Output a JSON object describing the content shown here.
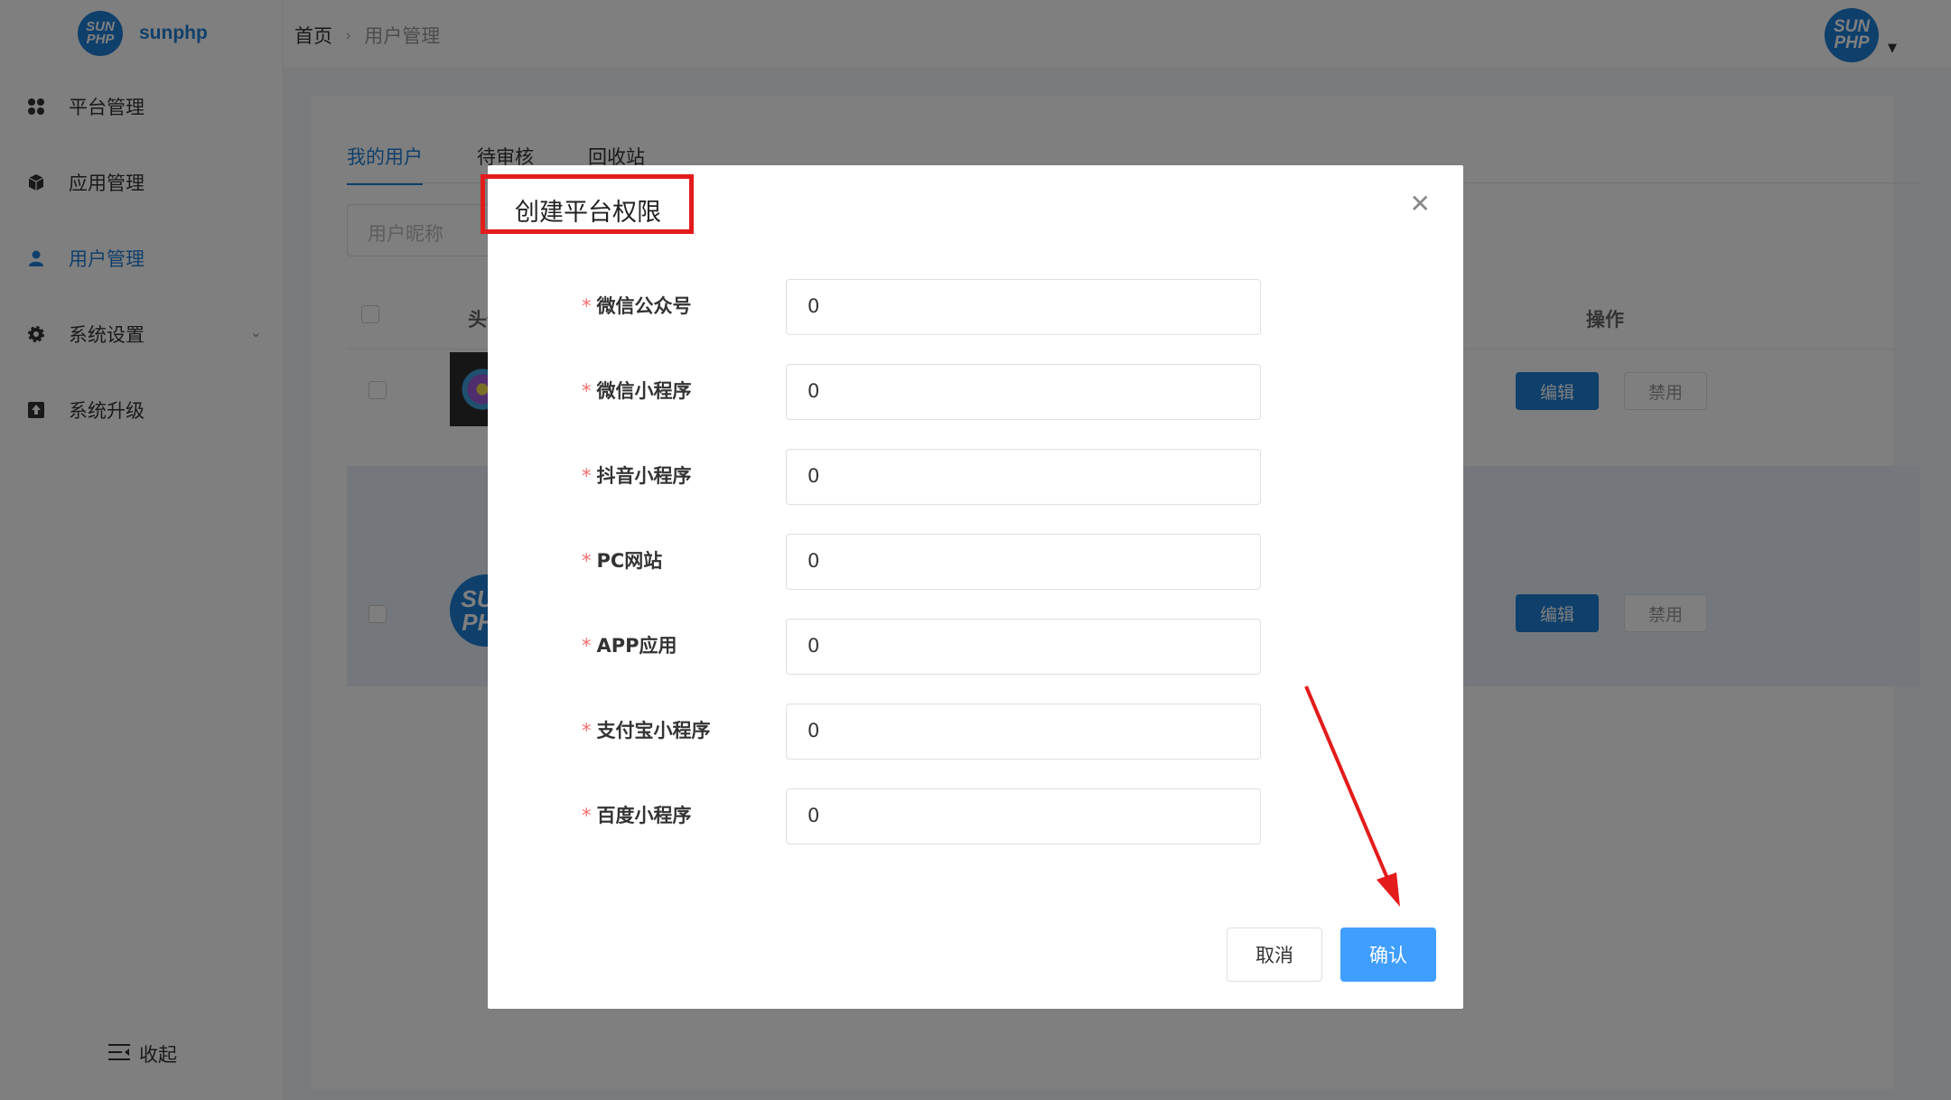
{
  "brand": {
    "name": "sunphp",
    "logo_line1": "SUN",
    "logo_line2": "PHP"
  },
  "colors": {
    "primary": "#1e7fd6",
    "dialog_primary": "#409eff",
    "highlight_box": "#e31b1b",
    "required": "#f56c6c"
  },
  "sidebar": {
    "items": [
      {
        "label": "平台管理",
        "icon": "grid-icon"
      },
      {
        "label": "应用管理",
        "icon": "cube-icon"
      },
      {
        "label": "用户管理",
        "icon": "user-icon",
        "active": true
      },
      {
        "label": "系统设置",
        "icon": "gear-icon"
      },
      {
        "label": "系统升级",
        "icon": "upload-icon"
      }
    ],
    "collapse_label": "收起"
  },
  "header": {
    "breadcrumb": [
      "首页",
      "用户管理"
    ]
  },
  "tabs": [
    "我的用户",
    "待审核",
    "回收站"
  ],
  "search": {
    "placeholder": "用户昵称"
  },
  "table": {
    "headers": {
      "avatar": "头像",
      "actions": "操作"
    },
    "rows": [
      {
        "avatar": "flower-photo",
        "edit": "编辑",
        "disable": "禁用"
      },
      {
        "avatar": "sunphp-logo",
        "edit": "编辑",
        "disable": "禁用"
      }
    ]
  },
  "dialog": {
    "title": "创建平台权限",
    "fields": [
      {
        "label": "微信公众号",
        "value": "0"
      },
      {
        "label": "微信小程序",
        "value": "0"
      },
      {
        "label": "抖音小程序",
        "value": "0"
      },
      {
        "label": "PC网站",
        "value": "0"
      },
      {
        "label": "APP应用",
        "value": "0"
      },
      {
        "label": "支付宝小程序",
        "value": "0"
      },
      {
        "label": "百度小程序",
        "value": "0"
      }
    ],
    "required_mark": "*",
    "cancel": "取消",
    "confirm": "确认"
  }
}
